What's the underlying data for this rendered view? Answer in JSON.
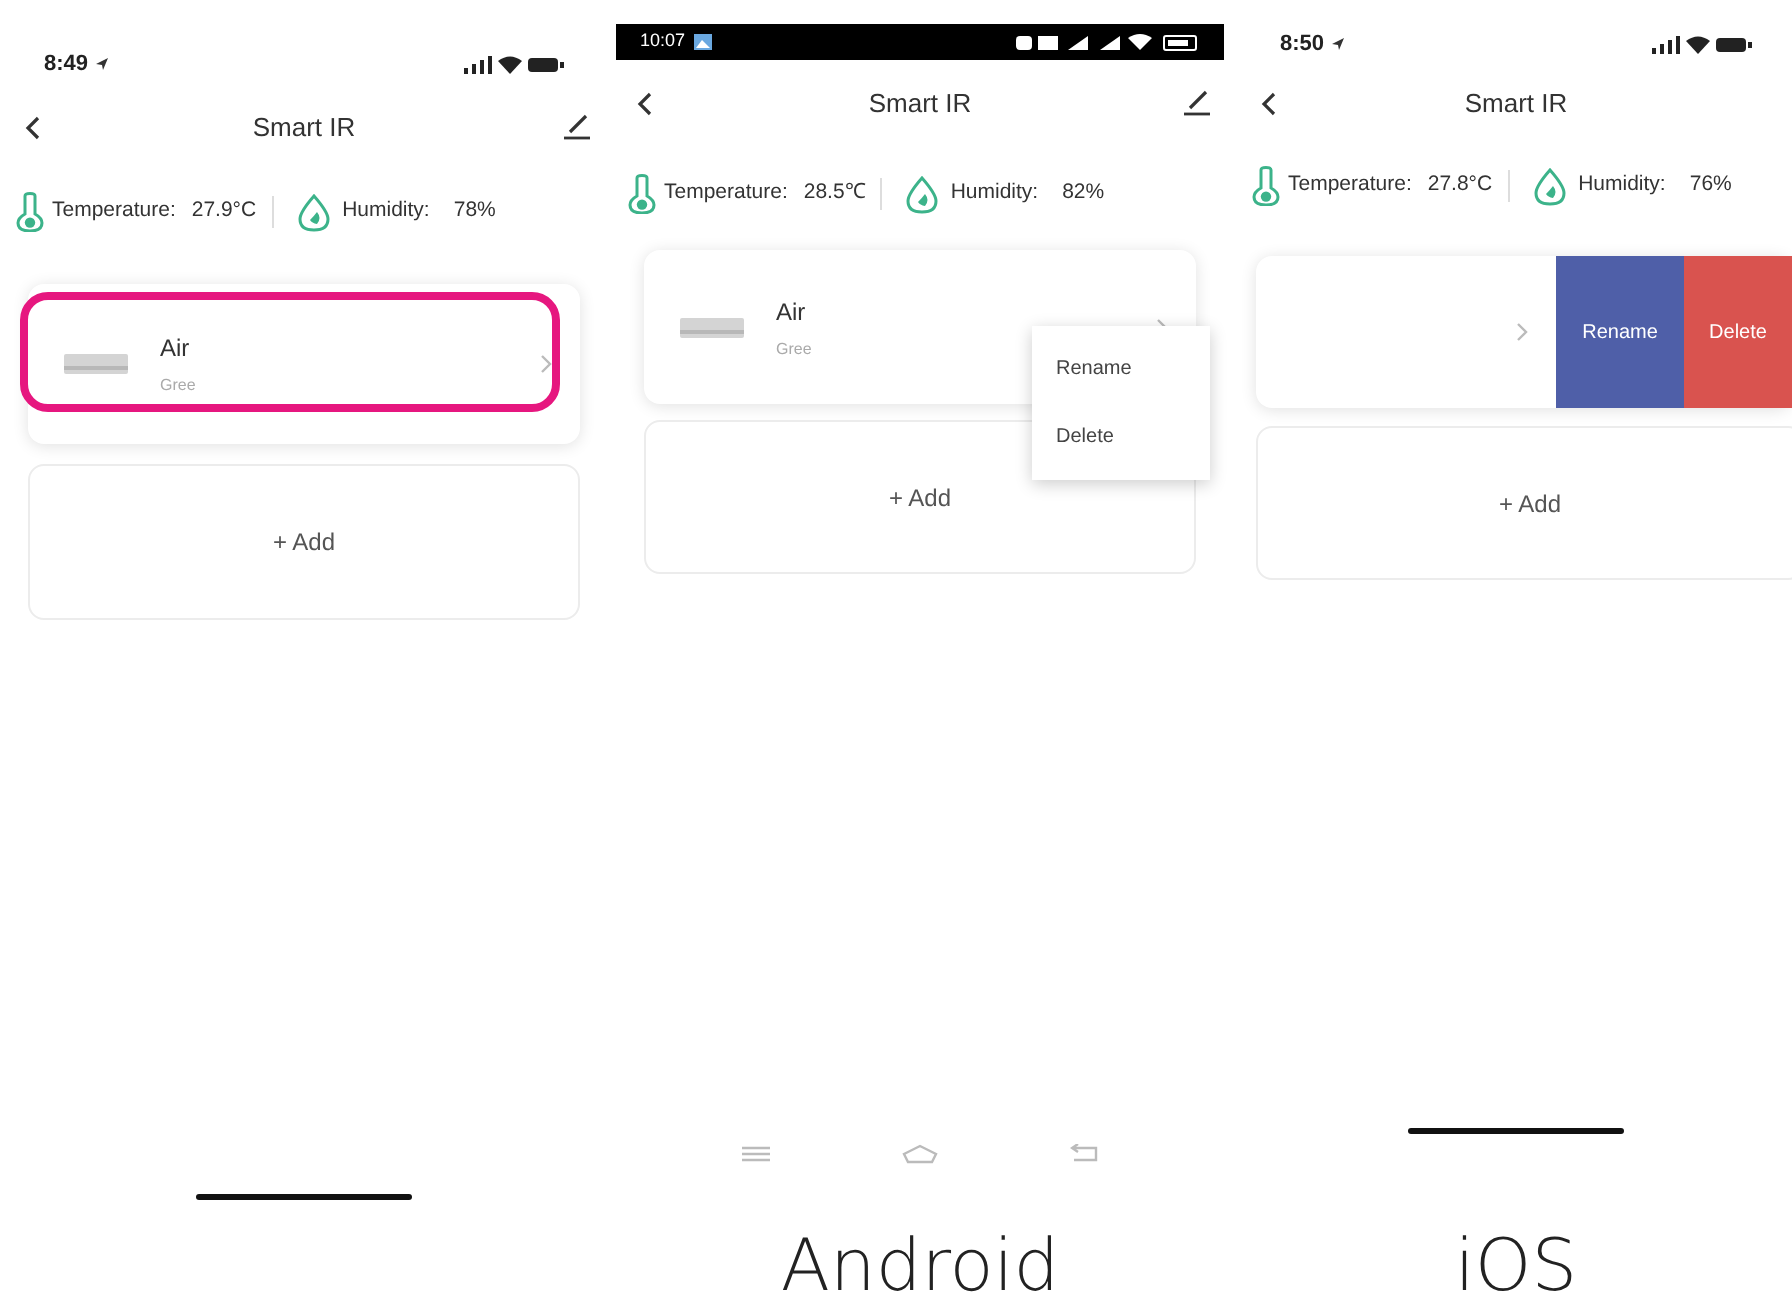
{
  "panels": [
    {
      "kind": "ios",
      "status_time": "8:49",
      "title": "Smart IR",
      "temperature_label": "Temperature:",
      "temperature": "27.9°C",
      "humidity_label": "Humidity:",
      "humidity": "78%",
      "device": {
        "name": "Air",
        "brand": "Gree",
        "highlighted": true
      },
      "add": "+ Add"
    },
    {
      "kind": "android",
      "status_time": "10:07",
      "title": "Smart IR",
      "temperature_label": "Temperature:",
      "temperature": "28.5℃",
      "humidity_label": "Humidity:",
      "humidity": "82%",
      "device": {
        "name": "Air",
        "brand": "Gree",
        "highlighted": false
      },
      "menu": [
        "Rename",
        "Delete"
      ],
      "add": "+ Add",
      "caption": "Android"
    },
    {
      "kind": "ios",
      "status_time": "8:50",
      "title": "Smart IR",
      "temperature_label": "Temperature:",
      "temperature": "27.8°C",
      "humidity_label": "Humidity:",
      "humidity": "76%",
      "device": {
        "highlighted": false
      },
      "swipe_actions": [
        {
          "label": "Rename",
          "color": "#4f5fa8"
        },
        {
          "label": "Delete",
          "color": "#d9534f"
        }
      ],
      "add": "+ Add",
      "caption": "iOS"
    }
  ]
}
